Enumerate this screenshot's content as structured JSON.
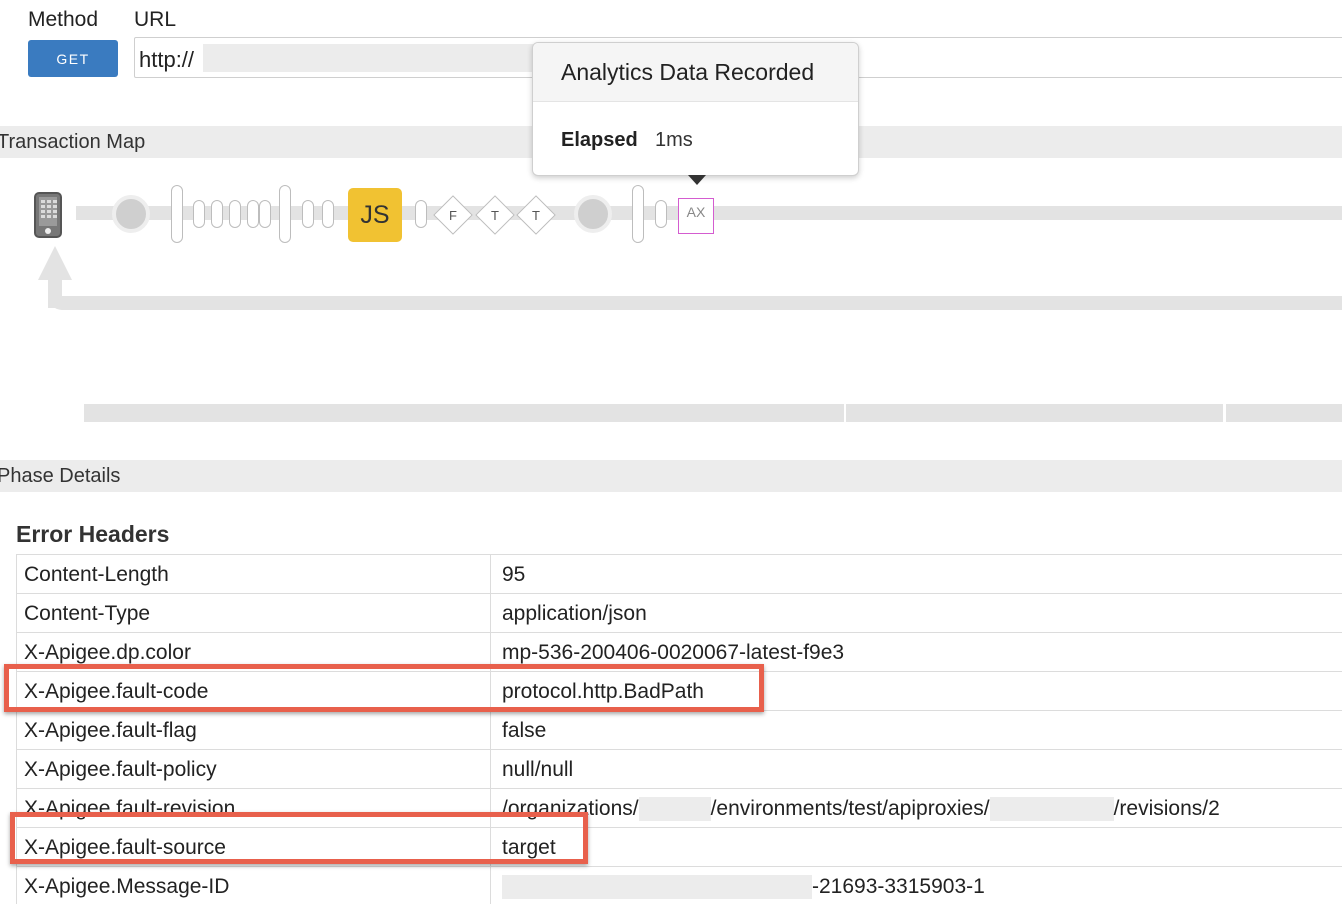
{
  "request": {
    "method_label": "Method",
    "url_label": "URL",
    "method_value": "GET",
    "url_value": "http://"
  },
  "sections": {
    "transaction_map": "Transaction Map",
    "phase_details": "Phase Details"
  },
  "transaction_map": {
    "js_label": "JS",
    "diamond_labels": [
      "F",
      "T",
      "T"
    ],
    "ax_label": "AX",
    "colors": {
      "js": "#f1c232",
      "ax_border": "#d45cd0",
      "track": "#e3e3e3"
    }
  },
  "popover": {
    "title": "Analytics Data Recorded",
    "key": "Elapsed",
    "value": "1ms"
  },
  "error_headers": {
    "title": "Error Headers",
    "rows": [
      {
        "name": "Content-Length",
        "value": "95"
      },
      {
        "name": "Content-Type",
        "value": "application/json"
      },
      {
        "name": "X-Apigee.dp.color",
        "value": "mp-536-200406-0020067-latest-f9e3"
      },
      {
        "name": "X-Apigee.fault-code",
        "value": "protocol.http.BadPath"
      },
      {
        "name": "X-Apigee.fault-flag",
        "value": "false"
      },
      {
        "name": "X-Apigee.fault-policy",
        "value": "null/null"
      },
      {
        "name": "X-Apigee.fault-revision",
        "value_parts": [
          "/organizations/",
          "/environments/test/apiproxies/",
          "/revisions/2"
        ]
      },
      {
        "name": "X-Apigee.fault-source",
        "value": "target"
      },
      {
        "name": "X-Apigee.Message-ID",
        "value": "-21693-3315903-1"
      }
    ],
    "highlight_color": "#e8604c"
  }
}
